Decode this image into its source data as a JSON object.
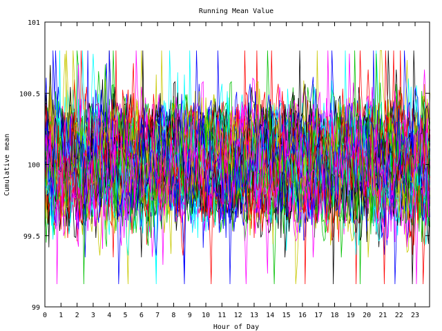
{
  "chart_data": {
    "type": "line",
    "title": "Running Mean Value",
    "xlabel": "Hour of Day",
    "ylabel": "Cumulative mean",
    "xlim": [
      0,
      23.9
    ],
    "ylim": [
      99,
      101
    ],
    "x_ticks": [
      "0",
      "1",
      "2",
      "3",
      "4",
      "5",
      "6",
      "7",
      "8",
      "9",
      "10",
      "11",
      "12",
      "13",
      "14",
      "15",
      "16",
      "17",
      "18",
      "19",
      "20",
      "21",
      "22",
      "23"
    ],
    "y_ticks": [
      "99",
      "99.5",
      "100",
      "100.5",
      "101"
    ],
    "grid": false,
    "legend": "none",
    "series_colors": [
      "#ff0000",
      "#00c000",
      "#0000ff",
      "#ff00ff",
      "#00ffff",
      "#000000",
      "#c8c800"
    ],
    "series_count": 60,
    "samples_per_hour": 12,
    "center_value": 100,
    "typical_range": [
      99.6,
      100.4
    ],
    "extremes": {
      "max": 100.8,
      "min": 99.0
    }
  }
}
